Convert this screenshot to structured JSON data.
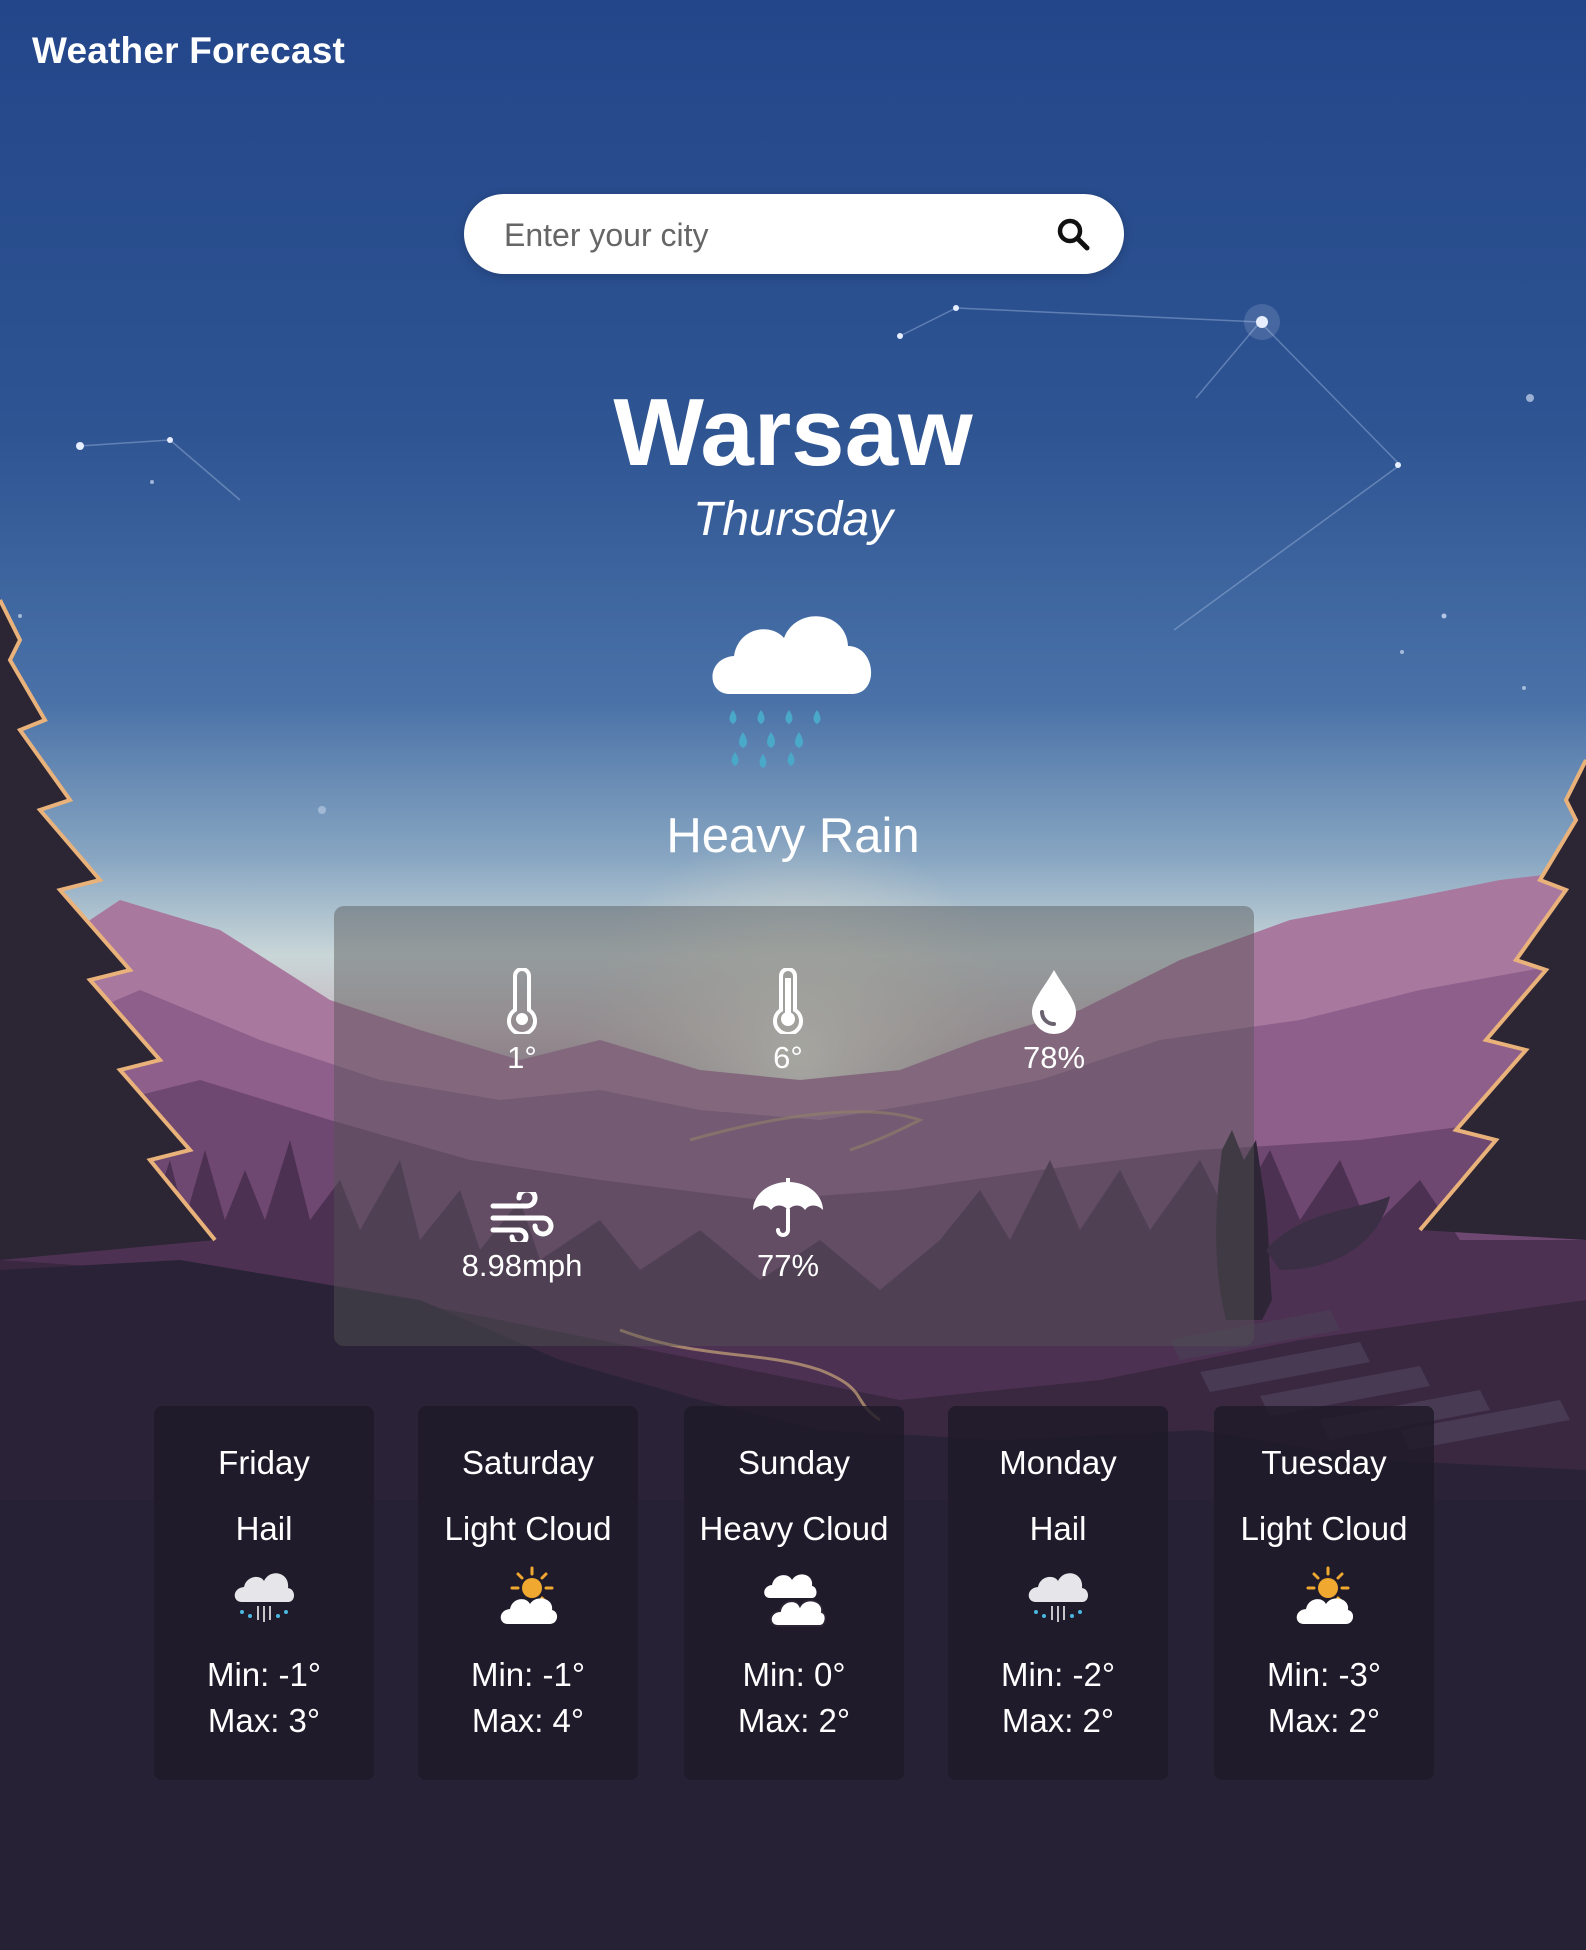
{
  "app": {
    "title": "Weather Forecast"
  },
  "search": {
    "placeholder": "Enter your city",
    "value": "",
    "icon": "search-icon"
  },
  "current": {
    "city": "Warsaw",
    "day": "Thursday",
    "condition": "Heavy Rain",
    "icon": "heavy-rain-icon",
    "stats": {
      "min_temp": {
        "value": "1°",
        "icon": "thermometer-low-icon"
      },
      "max_temp": {
        "value": "6°",
        "icon": "thermometer-high-icon"
      },
      "humidity": {
        "value": "78%",
        "icon": "humidity-drop-icon"
      },
      "wind": {
        "value": "8.98mph",
        "icon": "wind-icon"
      },
      "precipitation": {
        "value": "77%",
        "icon": "umbrella-icon"
      }
    }
  },
  "forecast": [
    {
      "day": "Friday",
      "condition": "Hail",
      "icon": "hail-icon",
      "min": "Min: -1°",
      "max": "Max: 3°"
    },
    {
      "day": "Saturday",
      "condition": "Light Cloud",
      "icon": "light-cloud-icon",
      "min": "Min: -1°",
      "max": "Max: 4°"
    },
    {
      "day": "Sunday",
      "condition": "Heavy Cloud",
      "icon": "heavy-cloud-icon",
      "min": "Min: 0°",
      "max": "Max: 2°"
    },
    {
      "day": "Monday",
      "condition": "Hail",
      "icon": "hail-icon",
      "min": "Min: -2°",
      "max": "Max: 2°"
    },
    {
      "day": "Tuesday",
      "condition": "Light Cloud",
      "icon": "light-cloud-icon",
      "min": "Min: -3°",
      "max": "Max: 2°"
    }
  ],
  "colors": {
    "sky_top": "#23478a",
    "sky_mid": "#4a73a8",
    "horizon": "#c9d6d8",
    "mountain": "#9b6a99",
    "ground": "#262134",
    "rain_drop": "#4aa8c8",
    "sun": "#f0a830"
  }
}
